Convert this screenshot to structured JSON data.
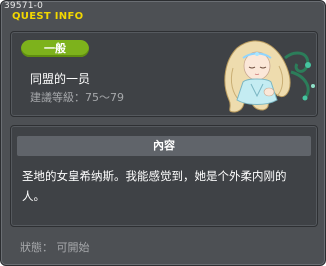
{
  "header": {
    "quest_id": "39571-0",
    "title": "QUEST INFO"
  },
  "quest": {
    "category_badge": "一般",
    "name": "同盟的一员",
    "recommended_level": "建議等級：75～79"
  },
  "content": {
    "header_label": "內容",
    "description": "圣地的女皇希纳斯。我能感觉到，她是个外柔内刚的人。"
  },
  "status": {
    "label": "狀態： 可開始"
  },
  "colors": {
    "title": "#f2d700",
    "badge": "#7db21c",
    "window_bg": "#4d5054",
    "panel_bg": "#3f4246",
    "muted_text": "#a6a8ab"
  }
}
